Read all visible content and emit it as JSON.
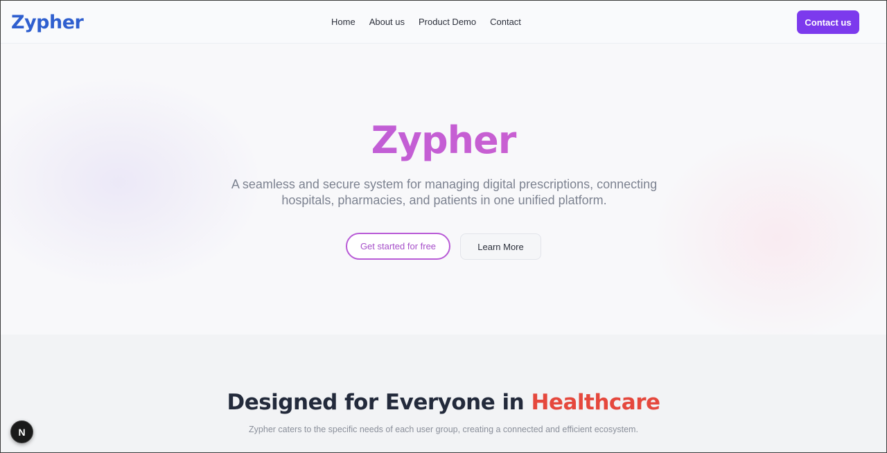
{
  "header": {
    "logo": "Zypher",
    "nav": [
      {
        "label": "Home"
      },
      {
        "label": "About us"
      },
      {
        "label": "Product Demo"
      },
      {
        "label": "Contact"
      }
    ],
    "cta_label": "Contact us"
  },
  "hero": {
    "title": "Zypher",
    "subtitle": "A seamless and secure system for managing digital prescriptions, connecting hospitals, pharmacies, and patients in one unified platform.",
    "primary_button": "Get started for free",
    "secondary_button": "Learn More"
  },
  "section": {
    "title_main": "Designed for Everyone in ",
    "title_accent": "Healthcare",
    "subtitle": "Zypher caters to the specific needs of each user group, creating a connected and efficient ecosystem."
  },
  "badge": {
    "label": "N",
    "icon": "nextjs-icon"
  },
  "colors": {
    "brand_blue": "#2f5fcf",
    "cta_purple": "#7c3aed",
    "hero_gradient_start": "#b05be0",
    "hero_gradient_end": "#d462c4",
    "accent_red": "#e5483d"
  }
}
